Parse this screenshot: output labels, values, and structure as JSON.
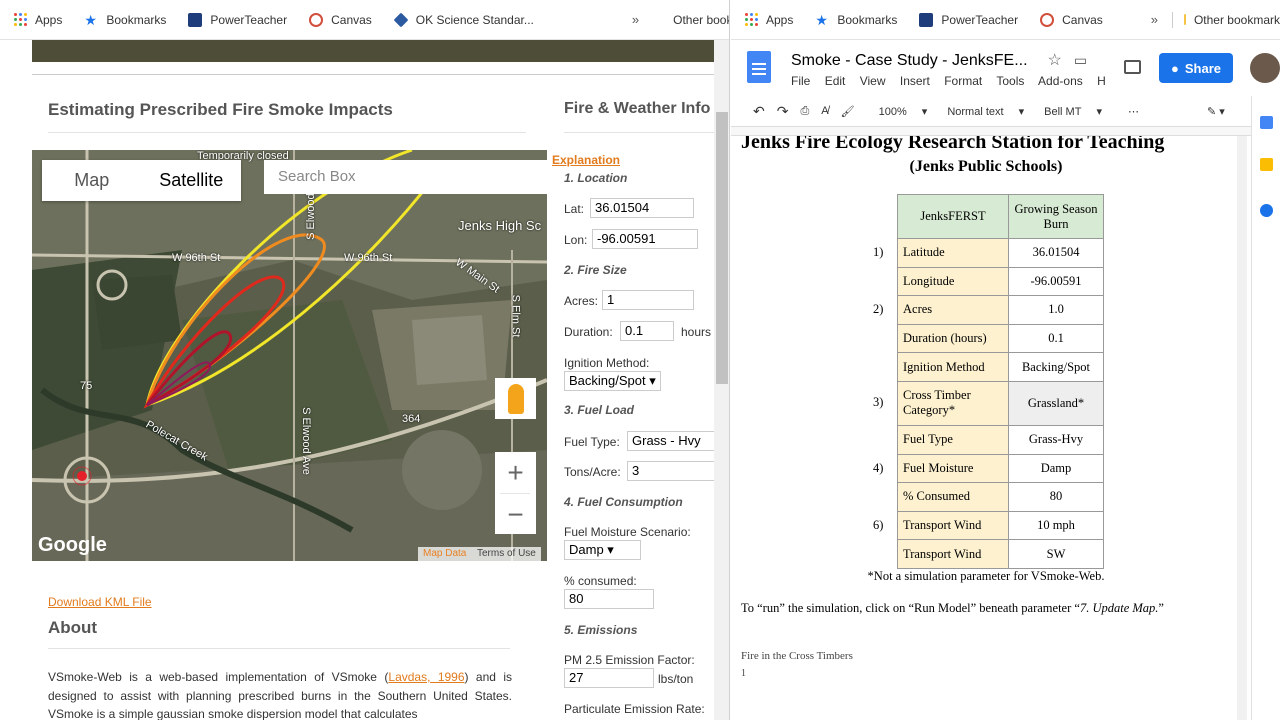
{
  "left_bookmarks": [
    {
      "label": "Apps",
      "icon": "apps-grid-icon"
    },
    {
      "label": "Bookmarks",
      "icon": "star-icon"
    },
    {
      "label": "PowerTeacher",
      "icon": "powerteacher-icon"
    },
    {
      "label": "Canvas",
      "icon": "canvas-icon"
    },
    {
      "label": "OK Science Standar...",
      "icon": "diamond-icon"
    }
  ],
  "left_other_bookmarks": "Other bookmarks",
  "right_bookmarks": [
    {
      "label": "Apps",
      "icon": "apps-grid-icon"
    },
    {
      "label": "Bookmarks",
      "icon": "star-icon"
    },
    {
      "label": "PowerTeacher",
      "icon": "powerteacher-icon"
    },
    {
      "label": "Canvas",
      "icon": "canvas-icon"
    }
  ],
  "right_other_bookmarks": "Other bookmark",
  "chevron": "»",
  "vsmoke": {
    "title": "Estimating Prescribed Fire Smoke Impacts",
    "panel_title": "Fire & Weather Info",
    "map": {
      "type_map": "Map",
      "type_satellite": "Satellite",
      "search_placeholder": "Search Box",
      "google": "Google",
      "map_data": "Map Data",
      "terms": "Terms of Use",
      "labels": [
        "Temporarily closed",
        "W 96th St",
        "W 96th St",
        "Jenks High Sc",
        "W Main St",
        "S Elm St",
        "S Elwood Ave",
        "Polecat Creek",
        "75",
        "364",
        "S Elwood Ave"
      ]
    },
    "explanation": "Explanation",
    "sec1": "1. Location",
    "lat_label": "Lat:",
    "lat": "36.01504",
    "lon_label": "Lon:",
    "lon": "-96.00591",
    "sec2": "2. Fire Size",
    "acres_label": "Acres:",
    "acres": "1",
    "duration_label": "Duration:",
    "duration": "0.1",
    "hours": "hours",
    "ignition_label": "Ignition Method:",
    "ignition": "Backing/Spot ▾",
    "sec3": "3. Fuel Load",
    "fueltype_label": "Fuel Type:",
    "fueltype": "Grass - Hvy",
    "tons_label": "Tons/Acre:",
    "tons": "3",
    "sec4": "4. Fuel Consumption",
    "moisture_label": "Fuel Moisture Scenario:",
    "moisture": "Damp        ▾",
    "consumed_label": "% consumed:",
    "consumed": "80",
    "sec5": "5. Emissions",
    "pm_label": "PM 2.5 Emission Factor:",
    "pm": "27",
    "pm_unit": "lbs/ton",
    "part_label": "Particulate Emission Rate:",
    "kml": "Download KML File",
    "about": "About",
    "about_text_1": "VSmoke-Web is a web-based implementation of VSmoke (",
    "about_link": "Lavdas, 1996",
    "about_text_2": ") and is designed to assist with planning prescribed burns in the Southern United States. VSmoke is a simple gaussian smoke dispersion model that calculates"
  },
  "docs": {
    "title": "Smoke - Case Study - JenksFE...",
    "menu": [
      "File",
      "Edit",
      "View",
      "Insert",
      "Format",
      "Tools",
      "Add-ons",
      "H"
    ],
    "share": "Share",
    "toolbar": {
      "zoom": "100%",
      "style": "Normal text",
      "font": "Bell MT"
    },
    "heading1": "Jenks Fire Ecology Research Station for Teaching",
    "heading2": "(Jenks Public Schools)",
    "table_header": [
      "JenksFERST",
      "Growing Season Burn"
    ],
    "rows": [
      {
        "num": "1)",
        "label": "Latitude",
        "value": "36.01504"
      },
      {
        "num": "",
        "label": "Longitude",
        "value": "-96.00591"
      },
      {
        "num": "2)",
        "label": "Acres",
        "value": "1.0"
      },
      {
        "num": "",
        "label": "Duration (hours)",
        "value": "0.1"
      },
      {
        "num": "",
        "label": "Ignition Method",
        "value": "Backing/Spot"
      },
      {
        "num": "3)",
        "label": "Cross Timber Category*",
        "value": "Grassland*"
      },
      {
        "num": "",
        "label": "Fuel Type",
        "value": "Grass-Hvy"
      },
      {
        "num": "4)",
        "label": "Fuel Moisture",
        "value": "Damp"
      },
      {
        "num": "",
        "label": "% Consumed",
        "value": "80"
      },
      {
        "num": "6)",
        "label": "Transport Wind",
        "value": "10 mph"
      },
      {
        "num": "",
        "label": "Transport Wind",
        "value": "SW"
      }
    ],
    "note": "*Not a simulation parameter for VSmoke-Web.",
    "run_text_1": "To “run” the simulation, click on “Run Model” beneath parameter “",
    "run_text_em": "7. Update Map.",
    "run_text_2": "”",
    "footer": "Fire in the Cross Timbers",
    "page_number": "1"
  },
  "colors": {
    "accent_orange": "#e27b1d",
    "olive": "#4e4e38",
    "share_blue": "#1a73e8",
    "table_yellow": "#fdf1cf",
    "table_green": "#d7ead3"
  }
}
